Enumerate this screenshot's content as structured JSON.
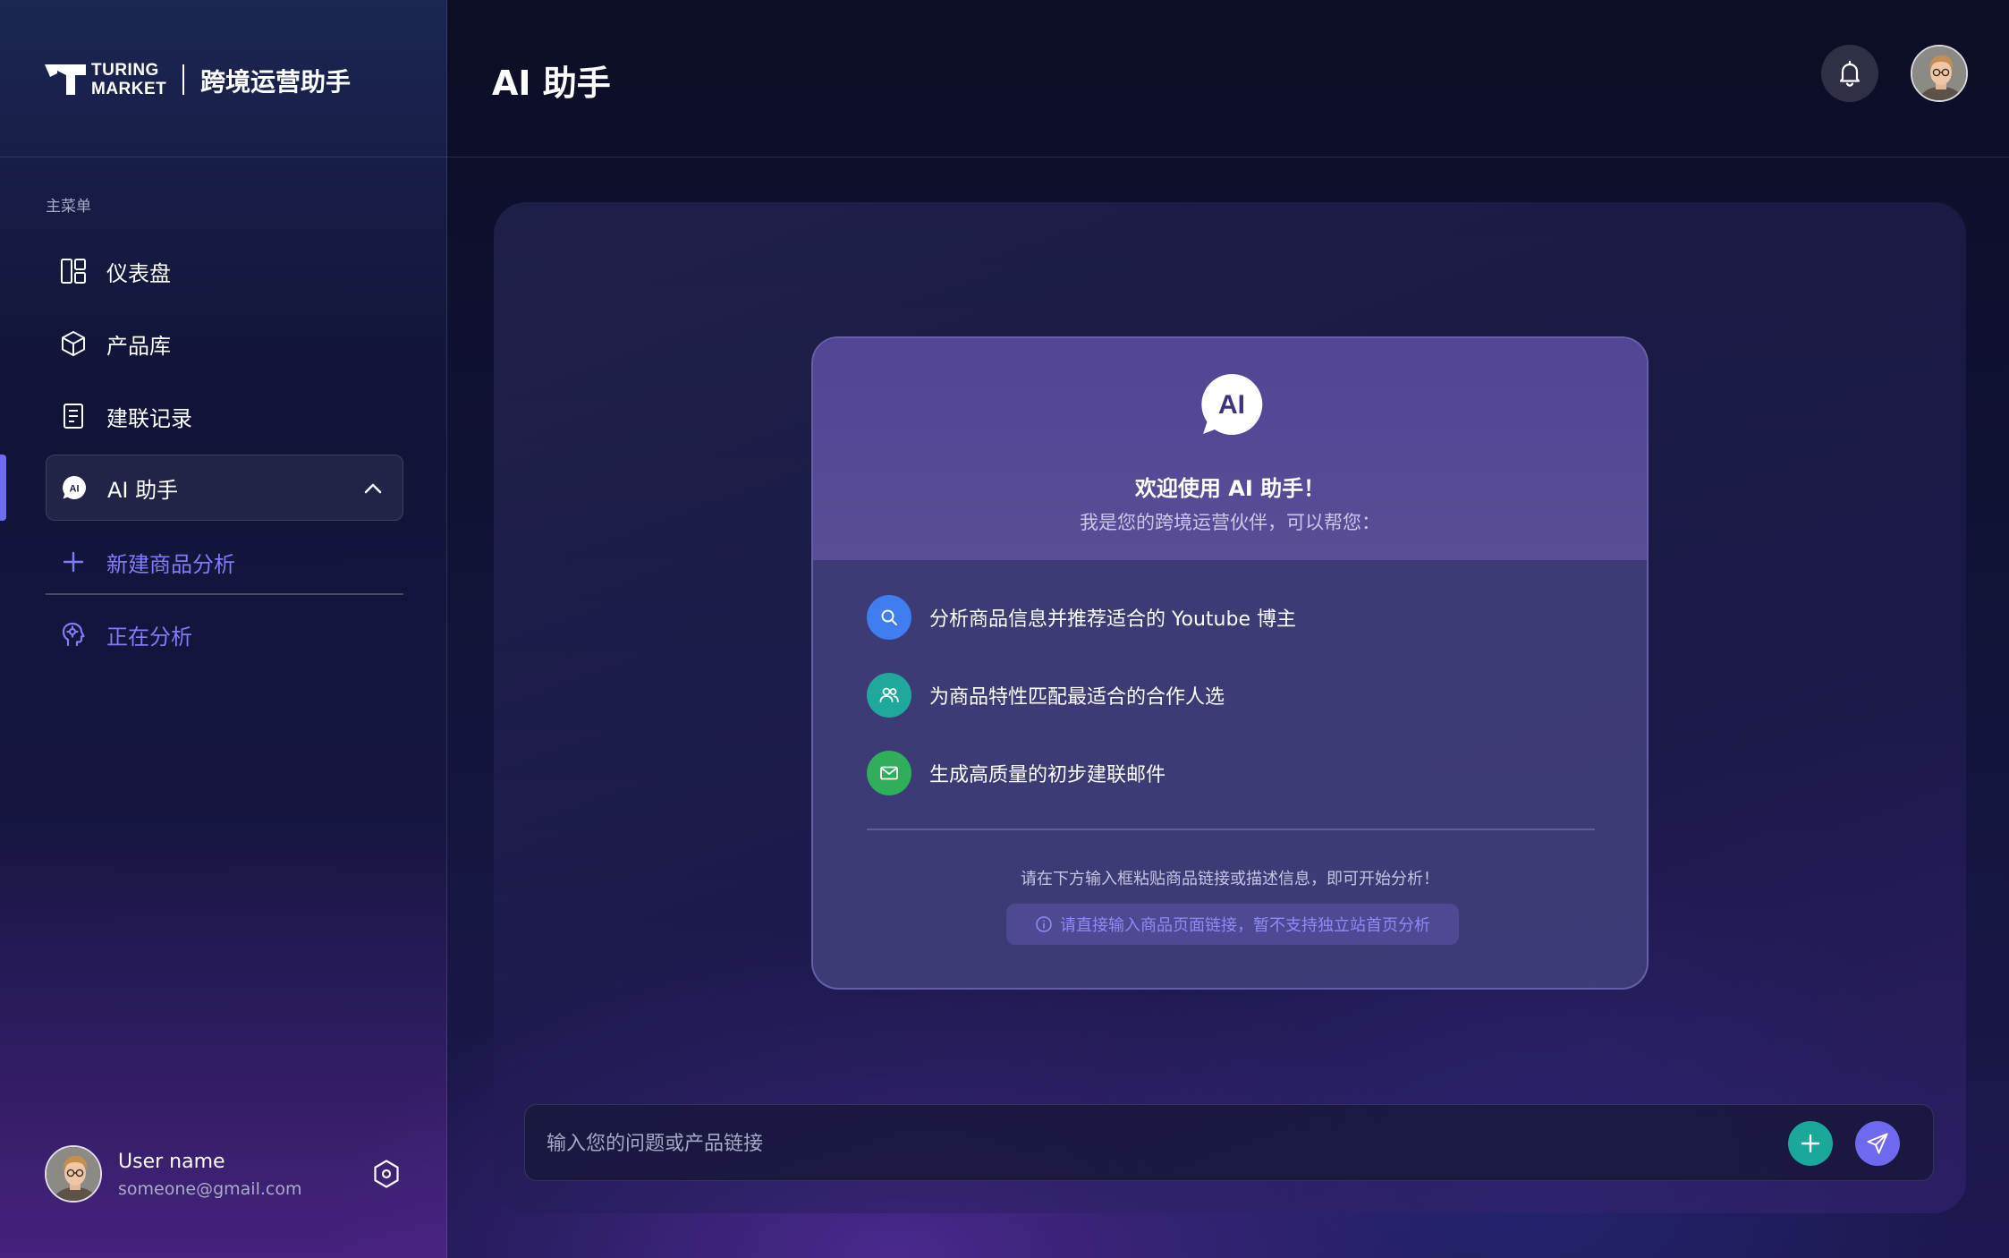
{
  "brand": {
    "logo_line1": "TURING",
    "logo_line2": "MARKET",
    "app_name": "跨境运营助手"
  },
  "sidebar": {
    "menu_heading": "主菜单",
    "items": [
      {
        "label": "仪表盘",
        "icon": "dashboard-icon"
      },
      {
        "label": "产品库",
        "icon": "cube-icon"
      },
      {
        "label": "建联记录",
        "icon": "document-icon"
      },
      {
        "label": "AI 助手",
        "icon": "ai-chat-icon",
        "active": true,
        "expanded": true
      }
    ],
    "subitems": [
      {
        "label": "新建商品分析",
        "icon": "plus-icon"
      },
      {
        "label": "正在分析",
        "icon": "brain-head-icon"
      }
    ],
    "accent_color": "#6f6cf0"
  },
  "user": {
    "name": "User name",
    "email": "someone@gmail.com"
  },
  "header": {
    "title": "AI 助手"
  },
  "welcome": {
    "badge": "AI",
    "title": "欢迎使用 AI 助手！",
    "subtitle": "我是您的跨境运营伙伴，可以帮您：",
    "features": [
      {
        "text": "分析商品信息并推荐适合的 Youtube 博主",
        "icon": "search-icon",
        "color": "#3f7df0"
      },
      {
        "text": "为商品特性匹配最适合的合作人选",
        "icon": "users-icon",
        "color": "#1fa89c"
      },
      {
        "text": "生成高质量的初步建联邮件",
        "icon": "mail-icon",
        "color": "#2fae5c"
      }
    ],
    "hint": "请在下方输入框粘贴商品链接或描述信息，即可开始分析！",
    "notice": "请直接输入商品页面链接，暂不支持独立站首页分析"
  },
  "input": {
    "placeholder": "输入您的问题或产品链接",
    "value": ""
  }
}
